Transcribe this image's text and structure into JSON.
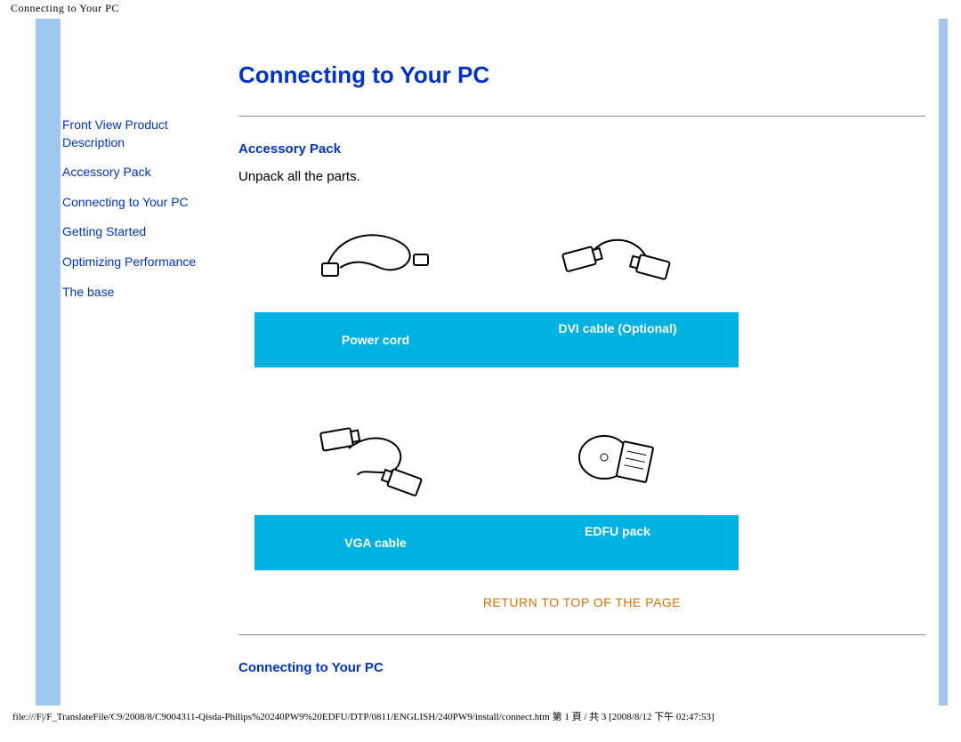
{
  "header": {
    "browser_title": "Connecting to Your PC"
  },
  "sidebar": {
    "items": [
      {
        "label": "Front View Product Description"
      },
      {
        "label": "Accessory Pack"
      },
      {
        "label": "Connecting to Your PC"
      },
      {
        "label": "Getting Started"
      },
      {
        "label": "Optimizing Performance"
      },
      {
        "label": "The base"
      }
    ]
  },
  "main": {
    "title": "Connecting to Your PC",
    "section1_heading": "Accessory Pack",
    "section1_body": "Unpack all the parts.",
    "grid": {
      "row1": [
        {
          "label": "Power cord",
          "icon": "power-cord"
        },
        {
          "label": "DVI cable (Optional)",
          "icon": "dvi-cable"
        }
      ],
      "row2": [
        {
          "label": "VGA cable",
          "icon": "vga-cable"
        },
        {
          "label": "EDFU pack",
          "icon": "edfu-pack"
        }
      ]
    },
    "return_link": "RETURN TO TOP OF THE PAGE",
    "section2_heading": "Connecting to Your PC"
  },
  "footer": {
    "path_text": "file:///F|/F_TranslateFile/C9/2008/8/C9004311-Qisda-Philips%20240PW9%20EDFU/DTP/0811/ENGLISH/240PW9/install/connect.htm 第 1 頁 / 共 3  [2008/8/12 下午 02:47:53]"
  },
  "colors": {
    "accent": "#0033cc",
    "cyan": "#00b2e2",
    "orange": "#e27000",
    "stripe": "#a1c7f0"
  }
}
